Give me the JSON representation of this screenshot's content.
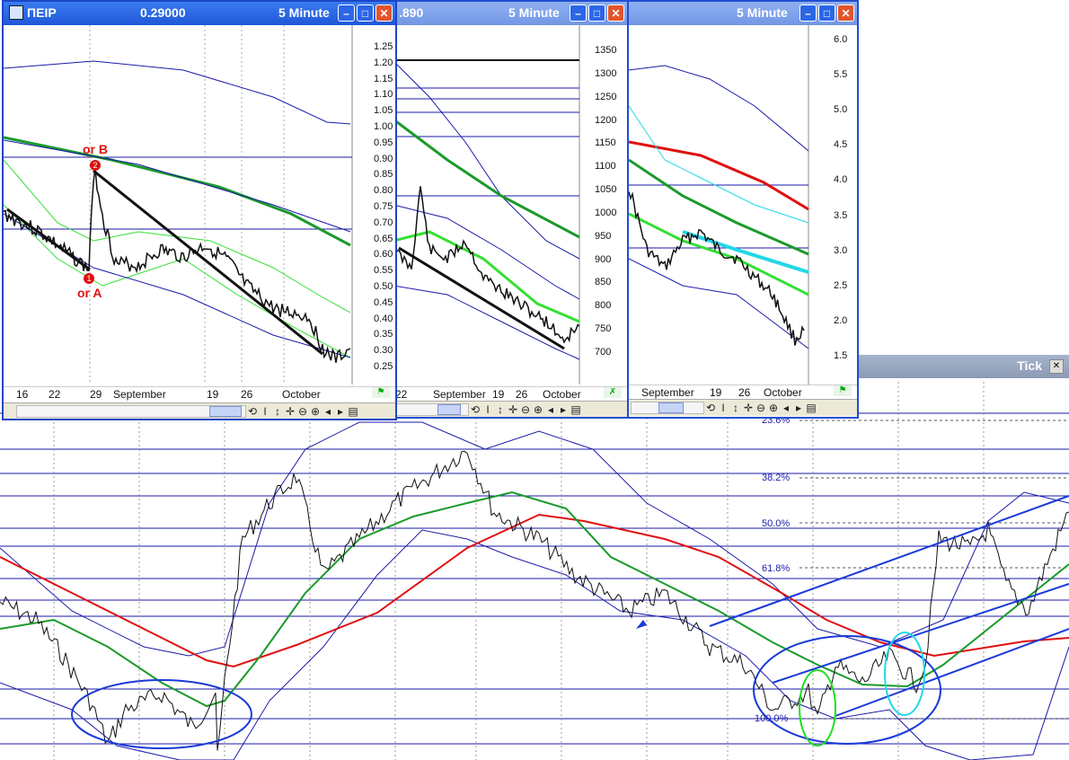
{
  "background_chart": {
    "fib_levels": [
      {
        "label": "23.6%"
      },
      {
        "label": "38.2%"
      },
      {
        "label": "50.0%"
      },
      {
        "label": "61.8%"
      },
      {
        "label": "100.0%"
      }
    ],
    "tick_panel": {
      "label": "Tick"
    }
  },
  "windows": [
    {
      "symbol": "ΠΕΙΡ",
      "price": "0.29000",
      "timeframe": "5 Minute",
      "y_axis": [
        "1.25",
        "1.20",
        "1.15",
        "1.10",
        "1.05",
        "1.00",
        "0.95",
        "0.90",
        "0.85",
        "0.80",
        "0.75",
        "0.70",
        "0.65",
        "0.60",
        "0.55",
        "0.50",
        "0.45",
        "0.40",
        "0.35",
        "0.30",
        "0.25"
      ],
      "dates": [
        "16",
        "22",
        "29",
        "September",
        "19",
        "26",
        "October"
      ],
      "wave_labels": {
        "orB": "or B",
        "orA": "or A",
        "one": "1",
        "two": "2"
      }
    },
    {
      "price": ".890",
      "timeframe": "5 Minute",
      "y_axis": [
        "1350",
        "1300",
        "1250",
        "1200",
        "1150",
        "1100",
        "1050",
        "1000",
        "950",
        "900",
        "850",
        "800",
        "750",
        "700"
      ],
      "dates": [
        "22",
        "September",
        "19",
        "26",
        "October"
      ]
    },
    {
      "timeframe": "5 Minute",
      "y_axis": [
        "6.0",
        "5.5",
        "5.0",
        "4.5",
        "4.0",
        "3.5",
        "3.0",
        "2.5",
        "2.0",
        "1.5"
      ],
      "dates": [
        "September",
        "19",
        "26",
        "October"
      ]
    }
  ],
  "colors": {
    "title_active": "#1f57d8",
    "title_inactive": "#7397e6",
    "ma_red": "#e01010",
    "ma_green": "#1a9a2a",
    "band_blue": "#1a1aa8",
    "light_green": "#33e033",
    "cyan": "#22d8e8"
  }
}
